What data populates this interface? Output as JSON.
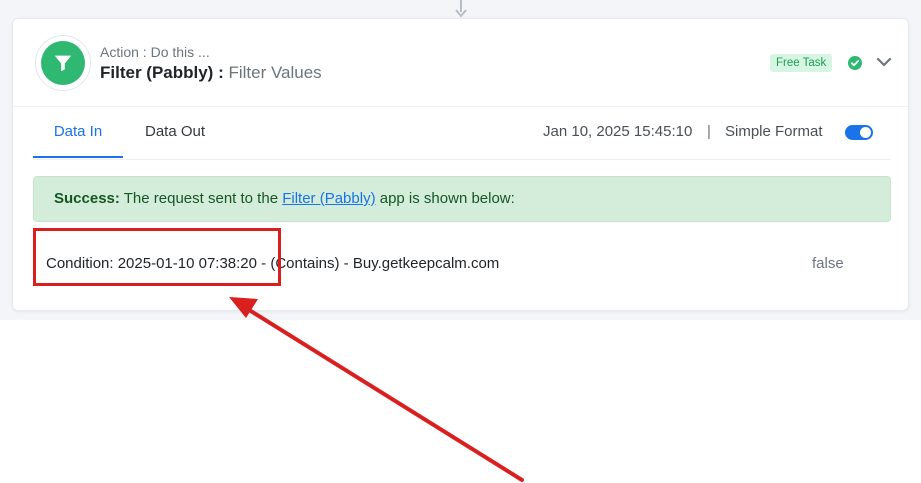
{
  "step": {
    "action_label": "Action : Do this ...",
    "app_name": "Filter (Pabbly)",
    "separator": " : ",
    "event_name": "Filter Values",
    "badge": "Free Task",
    "app_icon": "filter-icon",
    "status_icon": "check-circle-icon",
    "expand_icon": "chevron-down-icon"
  },
  "tabs": [
    {
      "label": "Data In",
      "active": true
    },
    {
      "label": "Data Out",
      "active": false
    }
  ],
  "meta": {
    "timestamp": "Jan 10, 2025 15:45:10",
    "divider": "|",
    "format_label": "Simple Format",
    "format_toggle_on": true
  },
  "alert": {
    "prefix": "Success:",
    "text_before": " The request sent to the ",
    "link": "Filter (Pabbly)",
    "text_after": " app is shown below:"
  },
  "rows": [
    {
      "key": "Condition: 2025-01-10 07:38:20 - (Contains) - Buy.getkeepcalm.com",
      "value": "false"
    }
  ],
  "colors": {
    "accent": "#1a73e8",
    "app_green": "#2eb872",
    "annotation_red": "#d9201f",
    "success_bg": "#d4edda"
  }
}
